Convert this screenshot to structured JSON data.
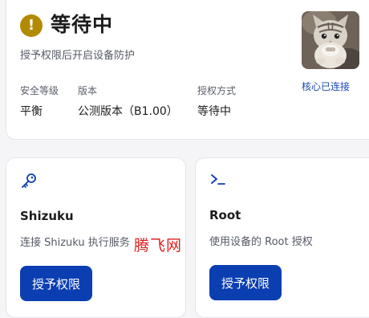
{
  "status": {
    "icon": "exclamation-icon",
    "title": "等待中",
    "description": "授予权限后开启设备防护",
    "accent_color": "#b28a00"
  },
  "info": [
    {
      "label": "安全等级",
      "value": "平衡"
    },
    {
      "label": "版本",
      "value": "公测版本（B1.00）"
    },
    {
      "label": "授权方式",
      "value": "等待中"
    }
  ],
  "core": {
    "status_text": "核心已连接",
    "avatar": "cat-avatar-image"
  },
  "cards": {
    "shizuku": {
      "icon": "key-icon",
      "title": "Shizuku",
      "description": "连接 Shizuku 执行服务",
      "button_label": "授予权限"
    },
    "root": {
      "icon": "terminal-icon",
      "title": "Root",
      "description": "使用设备的 Root 授权",
      "button_label": "授予权限"
    }
  },
  "watermark": "腾飞网",
  "colors": {
    "primary_button": "#0b3eb1",
    "link": "#1a49b0",
    "watermark": "#e02020"
  }
}
